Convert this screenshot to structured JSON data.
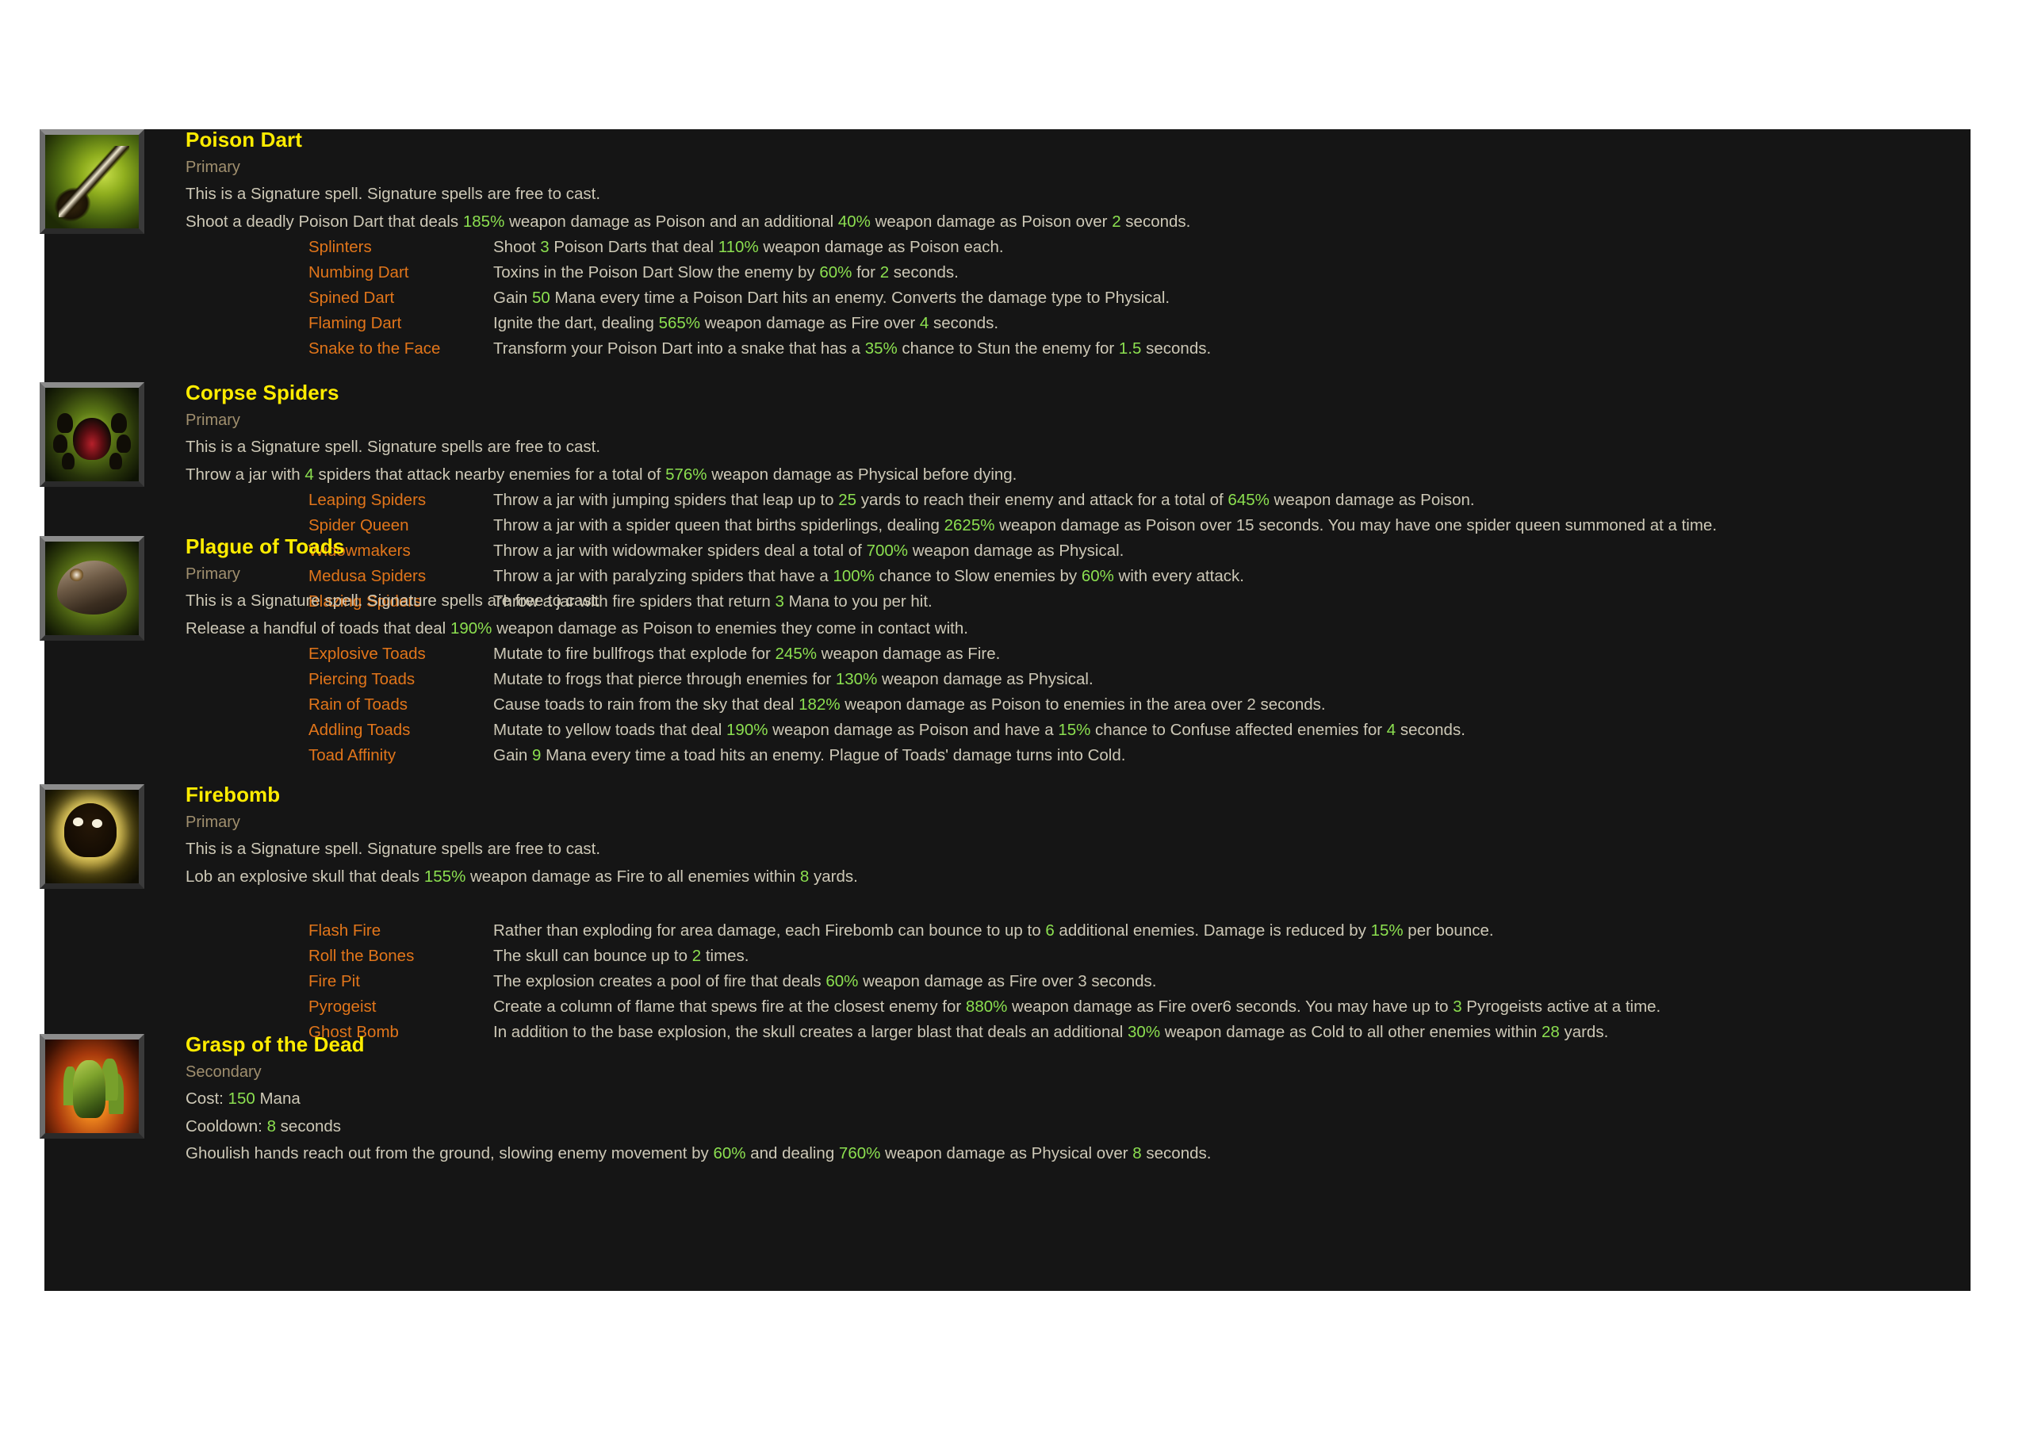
{
  "panel": {
    "background_color": "#151515",
    "title_color": "#ffec00",
    "rune_color": "#e1751a",
    "body_color": "#cdc8b6",
    "value_color": "#8ce050",
    "category_color": "#a08f6e"
  },
  "skills": [
    {
      "name": "Poison Dart",
      "icon": "poison-dart-icon",
      "category": "Primary",
      "signature_note": "This is a Signature spell. Signature spells are free to cast.",
      "description_parts": [
        {
          "t": "Shoot a deadly Poison Dart that deals ",
          "v": false
        },
        {
          "t": "185%",
          "v": true
        },
        {
          "t": " weapon damage as Poison and an additional ",
          "v": false
        },
        {
          "t": "40%",
          "v": true
        },
        {
          "t": " weapon damage as Poison over ",
          "v": false
        },
        {
          "t": "2",
          "v": true
        },
        {
          "t": " seconds.",
          "v": false
        }
      ],
      "runes": [
        {
          "name": "Splinters",
          "parts": [
            {
              "t": "Shoot ",
              "v": false
            },
            {
              "t": "3",
              "v": true
            },
            {
              "t": " Poison Darts that deal ",
              "v": false
            },
            {
              "t": "110%",
              "v": true
            },
            {
              "t": " weapon damage as Poison each.",
              "v": false
            }
          ]
        },
        {
          "name": "Numbing Dart",
          "parts": [
            {
              "t": "Toxins in the Poison Dart Slow the enemy by ",
              "v": false
            },
            {
              "t": "60%",
              "v": true
            },
            {
              "t": " for ",
              "v": false
            },
            {
              "t": "2",
              "v": true
            },
            {
              "t": " seconds.",
              "v": false
            }
          ]
        },
        {
          "name": "Spined Dart",
          "parts": [
            {
              "t": "Gain ",
              "v": false
            },
            {
              "t": "50",
              "v": true
            },
            {
              "t": " Mana every time a Poison Dart hits an enemy. Converts the damage type to Physical.",
              "v": false
            }
          ]
        },
        {
          "name": "Flaming Dart",
          "parts": [
            {
              "t": "Ignite the dart, dealing ",
              "v": false
            },
            {
              "t": "565%",
              "v": true
            },
            {
              "t": " weapon damage as Fire over ",
              "v": false
            },
            {
              "t": "4",
              "v": true
            },
            {
              "t": " seconds.",
              "v": false
            }
          ]
        },
        {
          "name": "Snake to the Face",
          "parts": [
            {
              "t": "Transform your Poison Dart into a snake that has a ",
              "v": false
            },
            {
              "t": "35%",
              "v": true
            },
            {
              "t": " chance to Stun the enemy for ",
              "v": false
            },
            {
              "t": "1.5",
              "v": true
            },
            {
              "t": " seconds.",
              "v": false
            }
          ]
        }
      ]
    },
    {
      "name": "Corpse Spiders",
      "icon": "corpse-spiders-icon",
      "category": "Primary",
      "signature_note": "This is a Signature spell. Signature spells are free to cast.",
      "description_parts": [
        {
          "t": "Throw a jar with ",
          "v": false
        },
        {
          "t": "4",
          "v": true
        },
        {
          "t": " spiders that attack nearby enemies for a total of ",
          "v": false
        },
        {
          "t": "576%",
          "v": true
        },
        {
          "t": " weapon damage as Physical before dying.",
          "v": false
        }
      ],
      "runes": [
        {
          "name": "Leaping Spiders",
          "parts": [
            {
              "t": "Throw a jar with jumping spiders that leap up to ",
              "v": false
            },
            {
              "t": "25",
              "v": true
            },
            {
              "t": " yards to reach their enemy and attack for a total of ",
              "v": false
            },
            {
              "t": "645%",
              "v": true
            },
            {
              "t": " weapon damage as Poison.",
              "v": false
            }
          ]
        },
        {
          "name": "Spider Queen",
          "parts": [
            {
              "t": "Throw a jar with a spider queen that births spiderlings, dealing ",
              "v": false
            },
            {
              "t": "2625%",
              "v": true
            },
            {
              "t": " weapon damage as Poison over 15 seconds. You may have one spider queen summoned at a time.",
              "v": false
            }
          ]
        },
        {
          "name": "Widowmakers",
          "parts": [
            {
              "t": "Throw a jar with widowmaker spiders deal a total of ",
              "v": false
            },
            {
              "t": "700%",
              "v": true
            },
            {
              "t": " weapon damage as Physical.",
              "v": false
            }
          ]
        },
        {
          "name": "Medusa Spiders",
          "parts": [
            {
              "t": "Throw a jar with paralyzing spiders that have a ",
              "v": false
            },
            {
              "t": "100%",
              "v": true
            },
            {
              "t": " chance to Slow enemies by ",
              "v": false
            },
            {
              "t": "60%",
              "v": true
            },
            {
              "t": " with every attack.",
              "v": false
            }
          ]
        },
        {
          "name": "Blazing Spiders",
          "parts": [
            {
              "t": "Throw a jar with fire spiders that return ",
              "v": false
            },
            {
              "t": "3",
              "v": true
            },
            {
              "t": " Mana to you per hit.",
              "v": false
            }
          ]
        }
      ]
    },
    {
      "name": "Plague of Toads",
      "icon": "plague-of-toads-icon",
      "category": "Primary",
      "signature_note": "This is a Signature spell. Signature spells are free to cast.",
      "description_parts": [
        {
          "t": "Release a handful of toads that deal ",
          "v": false
        },
        {
          "t": "190%",
          "v": true
        },
        {
          "t": " weapon damage as Poison to enemies they come in contact with.",
          "v": false
        }
      ],
      "runes": [
        {
          "name": "Explosive Toads",
          "parts": [
            {
              "t": "Mutate to fire bullfrogs that explode for ",
              "v": false
            },
            {
              "t": "245%",
              "v": true
            },
            {
              "t": " weapon damage as Fire.",
              "v": false
            }
          ]
        },
        {
          "name": "Piercing Toads",
          "parts": [
            {
              "t": "Mutate to frogs that pierce through enemies for ",
              "v": false
            },
            {
              "t": "130%",
              "v": true
            },
            {
              "t": " weapon damage as Physical.",
              "v": false
            }
          ]
        },
        {
          "name": "Rain of Toads",
          "parts": [
            {
              "t": "Cause toads to rain from the sky that deal ",
              "v": false
            },
            {
              "t": "182%",
              "v": true
            },
            {
              "t": " weapon damage as Poison to enemies in the area over 2 seconds.",
              "v": false
            }
          ]
        },
        {
          "name": "Addling Toads",
          "parts": [
            {
              "t": "Mutate to yellow toads that deal ",
              "v": false
            },
            {
              "t": "190%",
              "v": true
            },
            {
              "t": " weapon damage as Poison and have a ",
              "v": false
            },
            {
              "t": "15%",
              "v": true
            },
            {
              "t": " chance to Confuse affected enemies for ",
              "v": false
            },
            {
              "t": "4",
              "v": true
            },
            {
              "t": " seconds.",
              "v": false
            }
          ]
        },
        {
          "name": "Toad Affinity",
          "parts": [
            {
              "t": "Gain ",
              "v": false
            },
            {
              "t": "9",
              "v": true
            },
            {
              "t": " Mana every time a toad hits an enemy. Plague of Toads' damage turns into Cold.",
              "v": false
            }
          ]
        }
      ]
    },
    {
      "name": "Firebomb",
      "icon": "firebomb-icon",
      "category": "Primary",
      "signature_note": "This is a Signature spell. Signature spells are free to cast.",
      "description_parts": [
        {
          "t": "Lob an explosive skull that deals ",
          "v": false
        },
        {
          "t": "155%",
          "v": true
        },
        {
          "t": " weapon damage as Fire to all enemies within ",
          "v": false
        },
        {
          "t": "8",
          "v": true
        },
        {
          "t": " yards.",
          "v": false
        }
      ],
      "runes": [
        {
          "name": "Flash Fire",
          "parts": [
            {
              "t": "Rather than exploding for area damage, each Firebomb can bounce to up to ",
              "v": false
            },
            {
              "t": "6",
              "v": true
            },
            {
              "t": " additional enemies. Damage is reduced by ",
              "v": false
            },
            {
              "t": "15%",
              "v": true
            },
            {
              "t": " per bounce.",
              "v": false
            }
          ]
        },
        {
          "name": "Roll the Bones",
          "parts": [
            {
              "t": "The skull can bounce up to ",
              "v": false
            },
            {
              "t": "2",
              "v": true
            },
            {
              "t": " times.",
              "v": false
            }
          ]
        },
        {
          "name": "Fire Pit",
          "parts": [
            {
              "t": "The explosion creates a pool of fire that deals ",
              "v": false
            },
            {
              "t": "60%",
              "v": true
            },
            {
              "t": " weapon damage as Fire over 3 seconds.",
              "v": false
            }
          ]
        },
        {
          "name": "Pyrogeist",
          "parts": [
            {
              "t": "Create a column of flame that spews fire at the closest enemy for ",
              "v": false
            },
            {
              "t": "880%",
              "v": true
            },
            {
              "t": " weapon damage as Fire over6 seconds. You may have up to ",
              "v": false
            },
            {
              "t": "3",
              "v": true
            },
            {
              "t": " Pyrogeists active at a time.",
              "v": false
            }
          ]
        },
        {
          "name": "Ghost Bomb",
          "parts": [
            {
              "t": "In addition to the base explosion, the skull creates a larger blast that deals an additional ",
              "v": false
            },
            {
              "t": "30%",
              "v": true
            },
            {
              "t": " weapon damage as Cold to all other enemies within ",
              "v": false
            },
            {
              "t": "28",
              "v": true
            },
            {
              "t": " yards.",
              "v": false
            }
          ]
        }
      ]
    },
    {
      "name": "Grasp of the Dead",
      "icon": "grasp-of-the-dead-icon",
      "category": "Secondary",
      "cost_parts": [
        {
          "t": "Cost: ",
          "v": false
        },
        {
          "t": "150",
          "v": true
        },
        {
          "t": " Mana",
          "v": false
        }
      ],
      "cooldown_parts": [
        {
          "t": "Cooldown: ",
          "v": false
        },
        {
          "t": "8",
          "v": true
        },
        {
          "t": " seconds",
          "v": false
        }
      ],
      "description_parts": [
        {
          "t": "Ghoulish hands reach out from the ground, slowing enemy movement by ",
          "v": false
        },
        {
          "t": "60%",
          "v": true
        },
        {
          "t": " and dealing ",
          "v": false
        },
        {
          "t": "760%",
          "v": true
        },
        {
          "t": " weapon damage as Physical over ",
          "v": false
        },
        {
          "t": "8",
          "v": true
        },
        {
          "t": " seconds.",
          "v": false
        }
      ],
      "runes": []
    }
  ]
}
